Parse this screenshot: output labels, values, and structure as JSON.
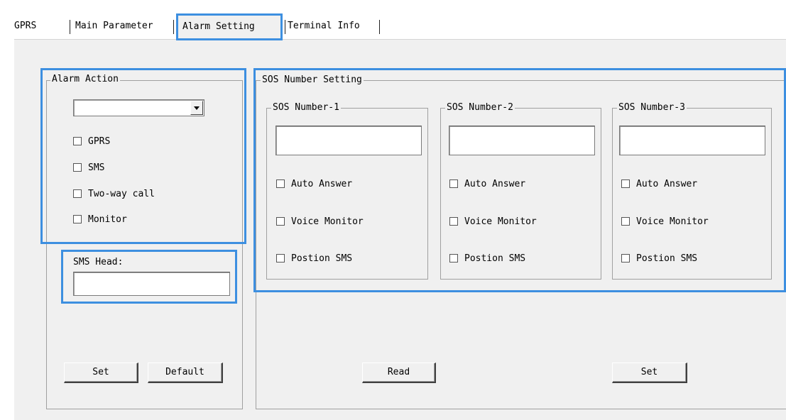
{
  "tabs": {
    "gprs": "GPRS",
    "main_parameter": "Main Parameter",
    "alarm_setting": "Alarm Setting",
    "terminal_info": "Terminal Info"
  },
  "alarm_action": {
    "title": "Alarm Action",
    "dropdown_value": "",
    "checkboxes": [
      "GPRS",
      "SMS",
      "Two-way call",
      "Monitor"
    ]
  },
  "sms_head": {
    "label": "SMS Head:",
    "value": ""
  },
  "left_buttons": {
    "set": "Set",
    "default": "Default"
  },
  "sos_setting": {
    "title": "SOS Number Setting",
    "numbers": [
      {
        "title": "SOS Number-1",
        "value": "",
        "auto_answer": "Auto Answer",
        "voice_monitor": "Voice Monitor",
        "position_sms": "Postion SMS"
      },
      {
        "title": "SOS Number-2",
        "value": "",
        "auto_answer": "Auto Answer",
        "voice_monitor": "Voice Monitor",
        "position_sms": "Postion SMS"
      },
      {
        "title": "SOS Number-3",
        "value": "",
        "auto_answer": "Auto Answer",
        "voice_monitor": "Voice Monitor",
        "position_sms": "Postion SMS"
      }
    ]
  },
  "right_buttons": {
    "read": "Read",
    "set": "Set"
  },
  "colors": {
    "highlight": "#3d8fe0",
    "panel_bg": "#f0f0f0"
  }
}
